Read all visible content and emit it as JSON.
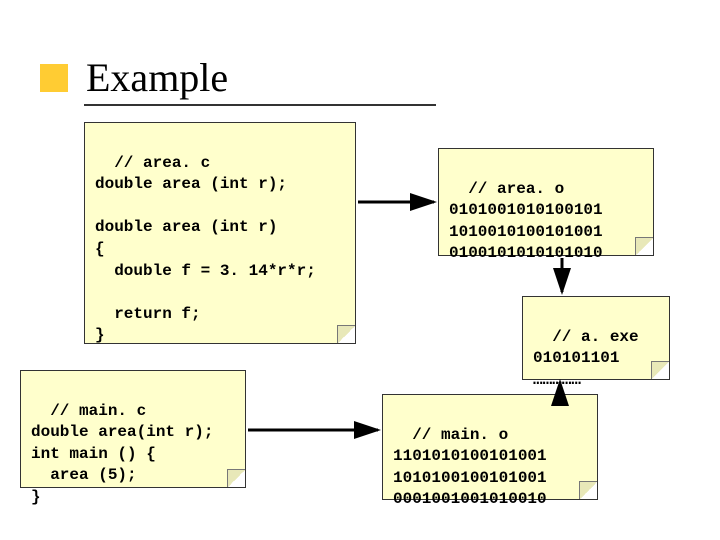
{
  "title": "Example",
  "notes": {
    "area_c": "// area. c\ndouble area (int r);\n\ndouble area (int r)\n{\n  double f = 3. 14*r*r;\n\n  return f;\n}",
    "area_o": "// area. o\n0101001010100101\n1010010100101001\n0100101010101010",
    "a_exe": "// a. exe\n010101101\n……………",
    "main_c": "// main. c\ndouble area(int r);\nint main () {\n  area (5);\n}",
    "main_o": "// main. o\n1101010100101001\n1010100100101001\n0001001001010010"
  }
}
